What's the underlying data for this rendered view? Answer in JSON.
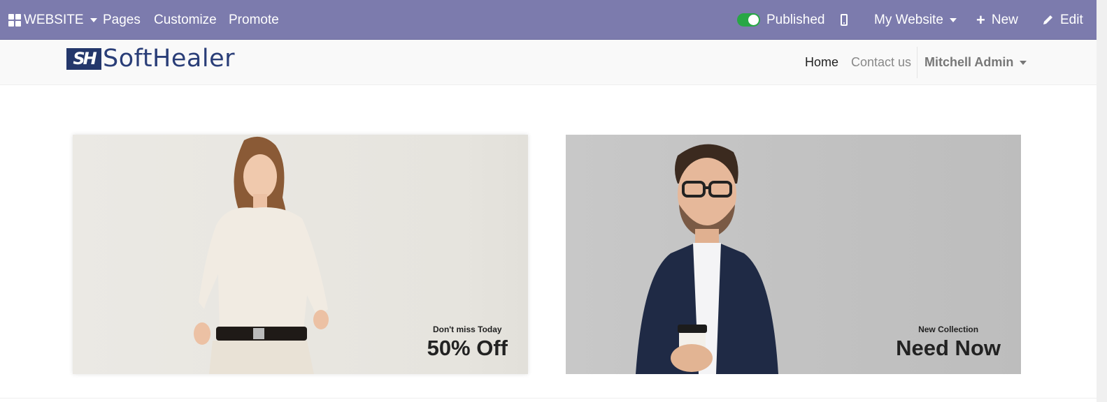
{
  "topbar": {
    "website_menu": "WEBSITE",
    "pages": "Pages",
    "customize": "Customize",
    "promote": "Promote",
    "published": "Published",
    "my_website": "My Website",
    "new": "New",
    "edit": "Edit",
    "color": "#7c7bad"
  },
  "header": {
    "logo_text": "SoftHealer",
    "logo_mark": "SH",
    "nav": {
      "home": "Home",
      "contact": "Contact us",
      "user": "Mitchell Admin"
    }
  },
  "banners": [
    {
      "subtitle": "Don't miss Today",
      "title": "50% Off"
    },
    {
      "subtitle": "New Collection",
      "title": "Need Now"
    }
  ]
}
